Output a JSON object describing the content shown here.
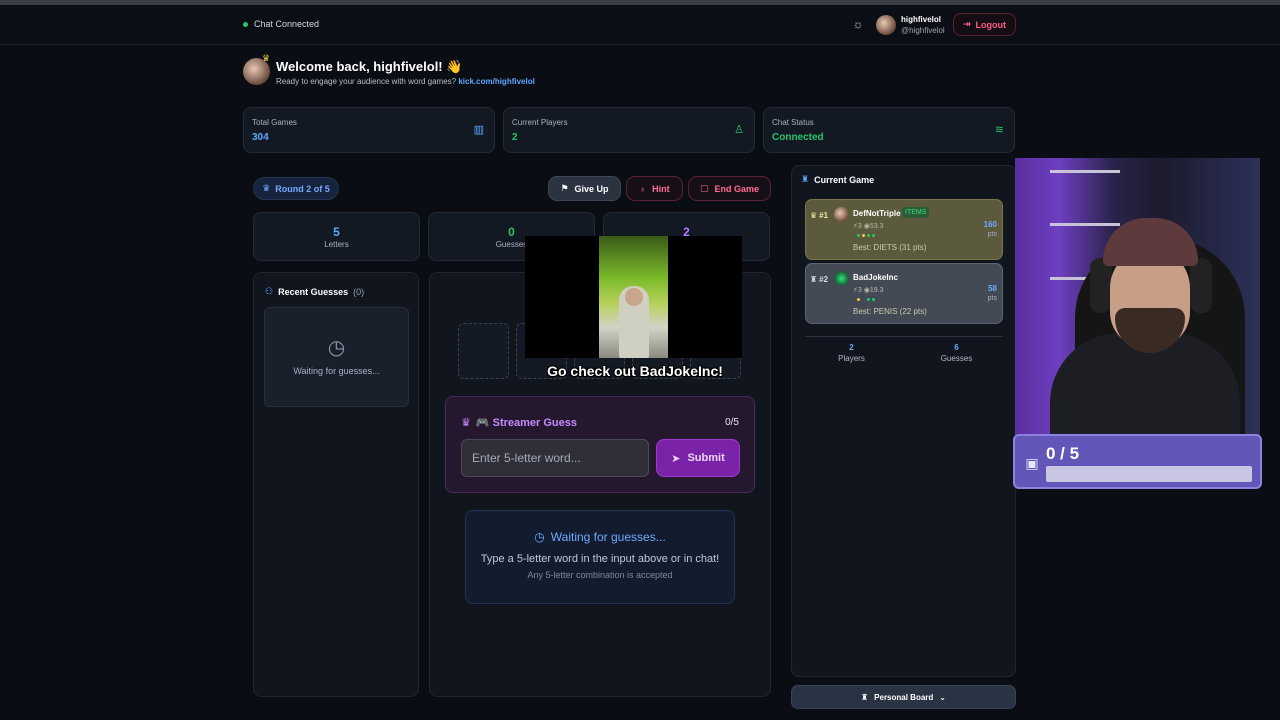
{
  "topbar": {
    "status": "Chat Connected",
    "user_name": "highfivelol",
    "user_handle": "@highfivelol",
    "logout_label": "Logout"
  },
  "welcome": {
    "title": "Welcome back, highfivelol! 👋",
    "subtitle": "Ready to engage your audience with word games?",
    "link": "kick.com/highfivelol"
  },
  "stats": [
    {
      "label": "Total Games",
      "value": "304",
      "color": "#5ea7ff",
      "icon": "bar-chart-icon"
    },
    {
      "label": "Current Players",
      "value": "2",
      "color": "#27c46b",
      "icon": "user-icon"
    },
    {
      "label": "Chat Status",
      "value": "Connected",
      "color": "#27c46b",
      "icon": "wifi-icon"
    }
  ],
  "game": {
    "round_label": "Round 2 of 5",
    "give_up_label": "Give Up",
    "hint_label": "Hint",
    "end_game_label": "End Game",
    "mini_stats": [
      {
        "value": "5",
        "label": "Letters",
        "color": "#5ea7ff"
      },
      {
        "value": "0",
        "label": "Guesses",
        "color": "#27c46b"
      },
      {
        "value": "2",
        "label": "",
        "color": "#b47bff"
      }
    ]
  },
  "recent": {
    "title": "Recent Guesses",
    "count": "(0)",
    "empty": "Waiting for guesses..."
  },
  "video_caption": "Go check out BadJokeInc!",
  "streamer_guess": {
    "title": "🎮 Streamer Guess",
    "count": "0/5",
    "placeholder": "Enter 5-letter word...",
    "submit_label": "Submit"
  },
  "waiting": {
    "title": "Waiting for guesses...",
    "subtitle": "Type a 5-letter word in the input above or in chat!",
    "note": "Any 5-letter combination is accepted"
  },
  "current_game": {
    "title": "Current Game",
    "players": [
      {
        "rank": "#1",
        "name": "DefNotTriple",
        "tag": "ITEMS",
        "stats": "⚡3 ◉53.3",
        "best": "Best: DIETS (31 pts)",
        "points": "160",
        "unit": "pts",
        "dots": [
          "#27c46b",
          "#f5c542",
          "#27c46b",
          "#27c46b"
        ]
      },
      {
        "rank": "#2",
        "name": "BadJokeInc",
        "tag": "",
        "stats": "⚡3 ◉19.3",
        "best": "Best: PENIS (22 pts)",
        "points": "58",
        "unit": "pts",
        "dots": [
          "#f5c542",
          "#444a55",
          "#27c46b",
          "#27c46b"
        ]
      }
    ],
    "summary": [
      {
        "value": "2",
        "label": "Players"
      },
      {
        "value": "6",
        "label": "Guesses"
      }
    ]
  },
  "personal_board_label": "Personal Board",
  "overlay_counter": {
    "text": "0 / 5",
    "progress": 0
  }
}
